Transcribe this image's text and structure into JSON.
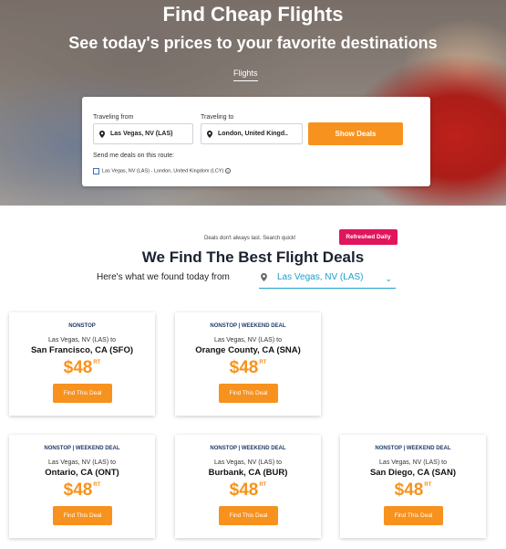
{
  "hero": {
    "title": "Find Cheap Flights",
    "subtitle": "See today's prices to your favorite destinations",
    "tab": "Flights"
  },
  "search": {
    "from_label": "Traveling from",
    "from_value": "Las Vegas, NV (LAS)",
    "to_label": "Traveling to",
    "to_value": "London, United Kingd..",
    "button": "Show Deals",
    "send_label": "Send me deals on this route:",
    "route_option": "Las Vegas, NV (LAS) - London, United Kingdom (LCY)"
  },
  "deals": {
    "note": "Deals don't always last. Search quick!",
    "badge": "Refreshed Daily",
    "title": "We Find The Best Flight Deals",
    "found_text": "Here's what we found today from",
    "origin": "Las Vegas, NV (LAS)",
    "cards": [
      {
        "tag": "NONSTOP",
        "from": "Las Vegas, NV (LAS) to",
        "to": "San Francisco, CA (SFO)",
        "price": "$48",
        "rt": "RT",
        "button": "Find This Deal"
      },
      {
        "tag": "NONSTOP | WEEKEND DEAL",
        "from": "Las Vegas, NV (LAS) to",
        "to": "Orange County, CA (SNA)",
        "price": "$48",
        "rt": "RT",
        "button": "Find This Deal"
      },
      {
        "tag": "NONSTOP | WEEKEND DEAL",
        "from": "Las Vegas, NV (LAS) to",
        "to": "Ontario, CA (ONT)",
        "price": "$48",
        "rt": "RT",
        "button": "Find This Deal"
      },
      {
        "tag": "NONSTOP | WEEKEND DEAL",
        "from": "Las Vegas, NV (LAS) to",
        "to": "Burbank, CA (BUR)",
        "price": "$48",
        "rt": "RT",
        "button": "Find This Deal"
      },
      {
        "tag": "NONSTOP | WEEKEND DEAL",
        "from": "Las Vegas, NV (LAS) to",
        "to": "San Diego, CA (SAN)",
        "price": "$48",
        "rt": "RT",
        "button": "Find This Deal"
      }
    ]
  },
  "colors": {
    "accent": "#f7921e",
    "badge": "#e0155c",
    "link": "#1aa1cf",
    "heading": "#1b2230"
  }
}
